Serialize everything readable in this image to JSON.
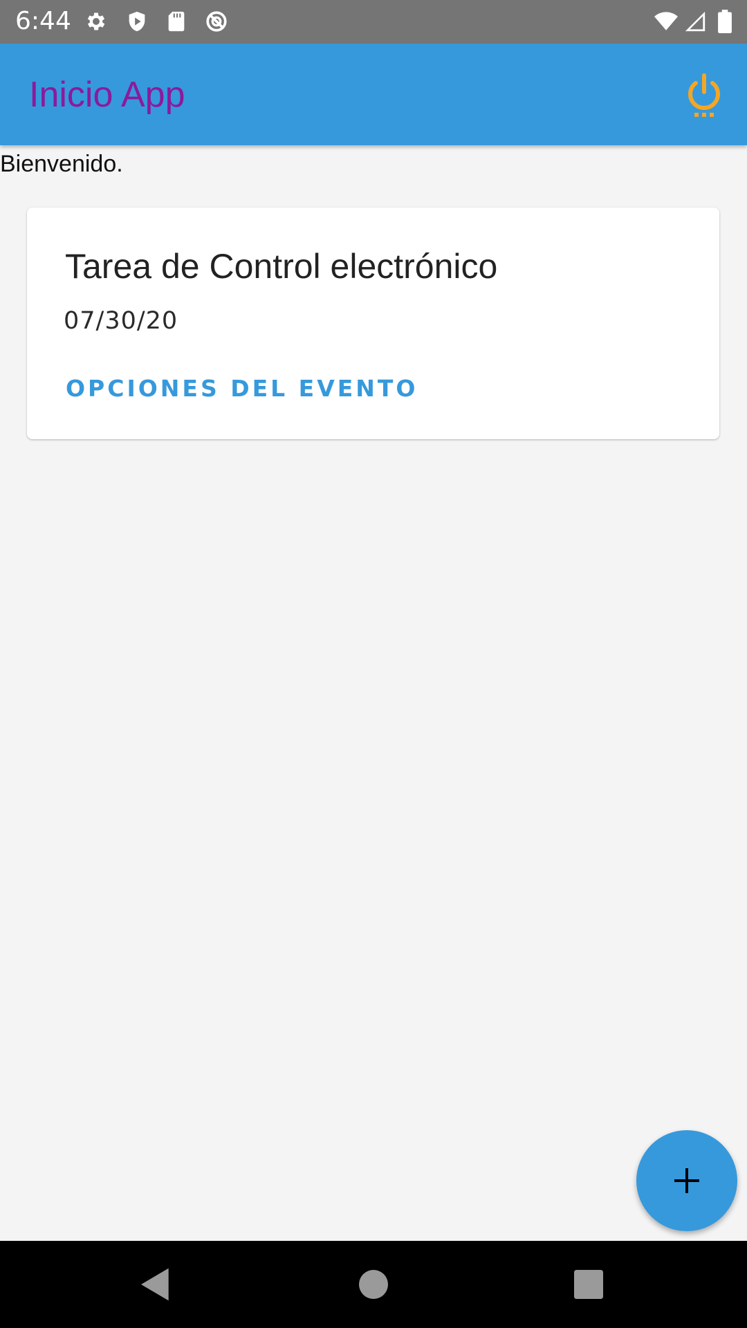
{
  "status_bar": {
    "time": "6:44",
    "icons": [
      "settings-gear-icon",
      "shield-icon",
      "sd-card-icon",
      "no-disturb-icon",
      "wifi-icon",
      "cell-signal-icon",
      "battery-icon"
    ]
  },
  "app_bar": {
    "title": "Inicio App",
    "title_color": "#8c1a9b",
    "background_color": "#3699dc",
    "action_icon": "power-icon",
    "action_icon_color": "#f5a623"
  },
  "welcome_text": "Bienvenido.",
  "event_card": {
    "title": "Tarea de Control electrónico",
    "date": "07/30/20",
    "action_label": "OPCIONES DEL EVENTO"
  },
  "fab": {
    "icon": "plus-icon",
    "color": "#3699dc"
  },
  "nav_bar": {
    "buttons": [
      "back-icon",
      "home-icon",
      "recents-icon"
    ]
  }
}
